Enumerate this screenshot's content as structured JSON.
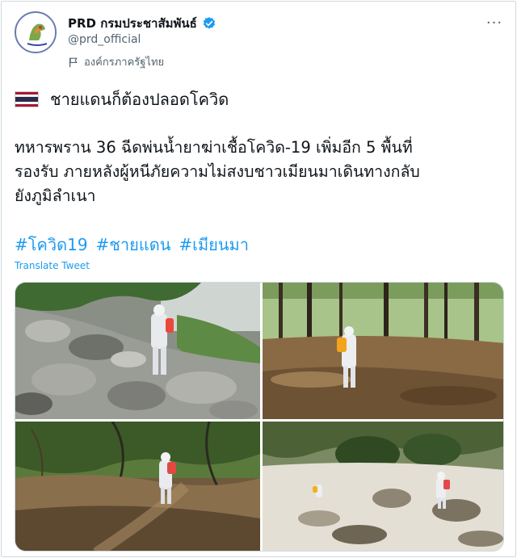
{
  "tweet": {
    "display_name": "PRD กรมประชาสัมพันธ์",
    "handle": "@prd_official",
    "affiliation": "องค์กรภาครัฐไทย",
    "verified": true,
    "headline": "ชายแดนก็ต้องปลอดโควิด",
    "body": "ทหารพราน 36 ฉีดพ่นน้ำยาฆ่าเชื้อโควิด-19 เพิ่มอีก 5 พื้นที่\nรองรับ ภายหลังผู้หนีภัยความไม่สงบชาวเมียนมาเดินทางกลับ\nยังภูมิลำเนา",
    "hashtags": [
      "#โควิด19",
      "#ชายแดน",
      "#เมียนมา"
    ],
    "translate_label": "Translate Tweet",
    "more_label": "···"
  },
  "icons": {
    "verified": "verified-badge-icon",
    "affiliation": "flag-icon",
    "more": "more-options-icon",
    "thai_flag": "thailand-flag-icon"
  },
  "colors": {
    "link": "#1d9bf0",
    "secondary_text": "#536471",
    "flag_red": "#a51931",
    "flag_white": "#f4f5f8",
    "flag_blue": "#2d2a4a"
  },
  "media": {
    "photos": [
      {
        "name": "photo-rocky-slope",
        "description_icon": "image"
      },
      {
        "name": "photo-forest-clearing",
        "description_icon": "image"
      },
      {
        "name": "photo-dirt-trail",
        "description_icon": "image"
      },
      {
        "name": "photo-sandy-riverbed",
        "description_icon": "image"
      }
    ]
  }
}
